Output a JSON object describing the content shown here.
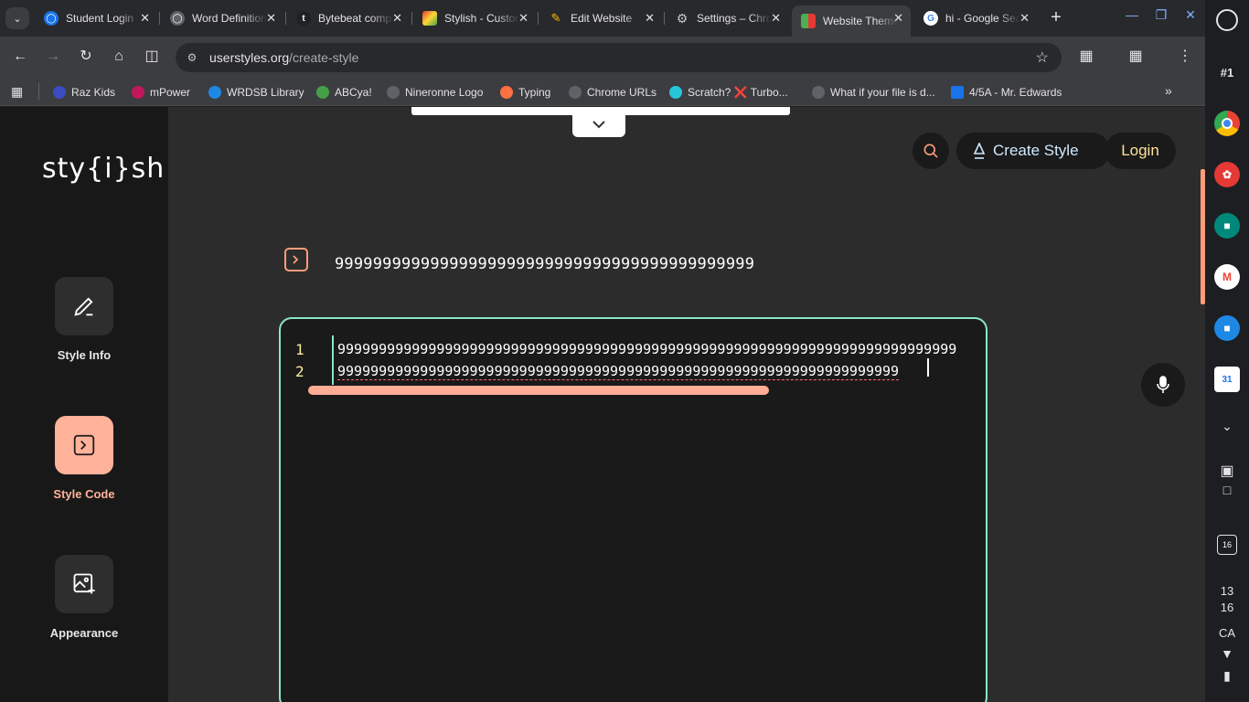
{
  "browser": {
    "tabs": [
      {
        "title": "Student Login",
        "favicon": "globe-icon",
        "active": false
      },
      {
        "title": "Word Definition",
        "favicon": "globe-icon",
        "active": false
      },
      {
        "title": "Bytebeat composer",
        "favicon": "bytebeat-icon",
        "active": false
      },
      {
        "title": "Stylish - Custom",
        "favicon": "stylish-icon",
        "active": false
      },
      {
        "title": "Edit Website",
        "favicon": "pencil-icon",
        "active": false
      },
      {
        "title": "Settings – Chrome",
        "favicon": "gear-icon",
        "active": false
      },
      {
        "title": "Website Themes",
        "favicon": "grid-icon",
        "active": true
      },
      {
        "title": "hi - Google Search",
        "favicon": "google-icon",
        "active": false
      }
    ],
    "url_host": "userstyles.org",
    "url_path": "/create-style",
    "bookmarks": [
      {
        "label": "Raz Kids",
        "color": "#3b4cc0"
      },
      {
        "label": "mPower",
        "color": "#c2185b"
      },
      {
        "label": "WRDSB Library",
        "color": "#1e88e5"
      },
      {
        "label": "ABCya!",
        "color": "#43a047"
      },
      {
        "label": "Nineronne Logo",
        "color": "#5f6368"
      },
      {
        "label": "Typing",
        "color": "#ff7043"
      },
      {
        "label": "Chrome URLs",
        "color": "#5f6368"
      },
      {
        "label": "Scratch? ❌ Turbo...",
        "color": "#26c6da"
      },
      {
        "label": "What if your file is d...",
        "color": "#5f6368"
      },
      {
        "label": "4/5A - Mr. Edwards",
        "color": "#1a73e8"
      }
    ]
  },
  "shelf": {
    "desk_label": "#1",
    "date_day": "16",
    "time_hour": "13",
    "time_min": "16",
    "locale": "CA"
  },
  "site": {
    "logo_text": "sty{i}sh",
    "nav": [
      {
        "label": "Style Info",
        "icon": "pencil-icon",
        "active": false
      },
      {
        "label": "Style Code",
        "icon": "code-prompt-icon",
        "active": true
      },
      {
        "label": "Appearance",
        "icon": "image-add-icon",
        "active": false
      }
    ],
    "create_label": "Create Style",
    "login_label": "Login",
    "style_title": "99999999999999999999999999999999999999999999",
    "editor": {
      "line_numbers": [
        "1",
        "2"
      ],
      "lines": [
        "999999999999999999999999999999999999999999999999999999999999999999999999999",
        "99999999999999999999999999999999999999999999999999999999999999999999"
      ]
    },
    "colors": {
      "accent_orange": "#ff9d7a",
      "accent_mint": "#8be6c4",
      "login_yellow": "#ffe39a"
    }
  }
}
